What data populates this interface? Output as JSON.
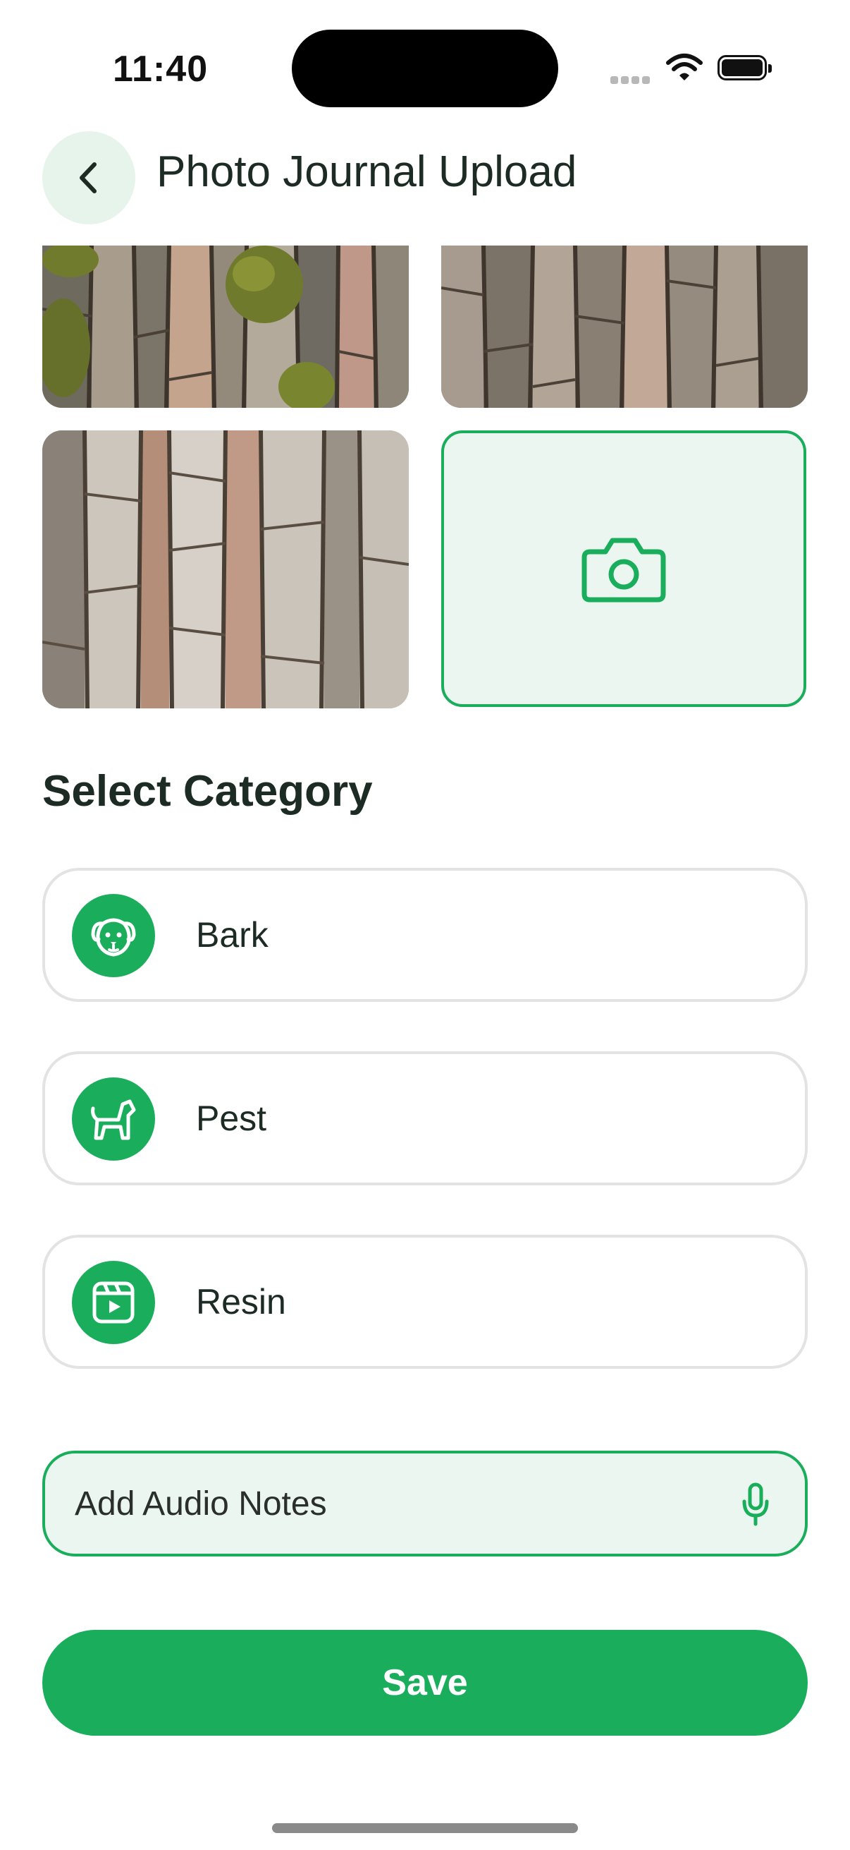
{
  "status_bar": {
    "time": "11:40"
  },
  "header": {
    "title": "Photo Journal Upload",
    "back_icon": "chevron-left-icon"
  },
  "photos": [
    {
      "name": "bark-photo-mossy"
    },
    {
      "name": "bark-photo-gray"
    },
    {
      "name": "bark-photo-pale"
    }
  ],
  "add_photo": {
    "icon": "camera-icon"
  },
  "section": {
    "title": "Select Category"
  },
  "categories": [
    {
      "label": "Bark",
      "icon": "dog-face-icon"
    },
    {
      "label": "Pest",
      "icon": "dog-icon"
    },
    {
      "label": "Resin",
      "icon": "video-clip-icon"
    }
  ],
  "audio": {
    "placeholder": "Add Audio Notes",
    "icon": "microphone-icon"
  },
  "save": {
    "label": "Save"
  },
  "colors": {
    "accent": "#1aae5c",
    "accent_soft": "#eaf6ef",
    "text": "#1c2b23"
  }
}
